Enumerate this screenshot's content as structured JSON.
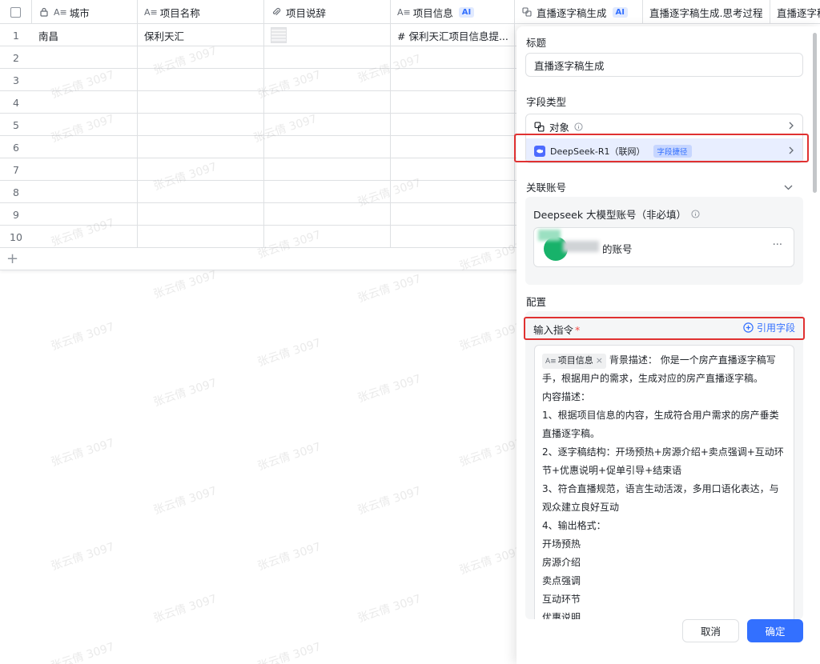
{
  "table": {
    "columns": [
      {
        "name": "城市",
        "icon": "text-field-icon"
      },
      {
        "name": "项目名称",
        "icon": "text-field-icon"
      },
      {
        "name": "项目说辞",
        "icon": "attachment-icon"
      },
      {
        "name": "项目信息",
        "icon": "text-field-icon",
        "tag": "AI"
      },
      {
        "name": "直播逐字稿生成",
        "icon": "object-icon",
        "tag": "AI"
      },
      {
        "name": "直播逐字稿生成.思考过程"
      },
      {
        "name": "直播逐字稿"
      }
    ],
    "rows": [
      {
        "num": "1",
        "city": "南昌",
        "project": "保利天汇",
        "info": "# 保利天汇项目信息提..."
      },
      {
        "num": "2"
      },
      {
        "num": "3"
      },
      {
        "num": "4"
      },
      {
        "num": "5"
      },
      {
        "num": "6"
      },
      {
        "num": "7"
      },
      {
        "num": "8"
      },
      {
        "num": "9"
      },
      {
        "num": "10"
      }
    ],
    "add_row": "+"
  },
  "watermark": "张云倩 3097",
  "panel": {
    "title_label": "标题",
    "title_value": "直播逐字稿生成",
    "type_label": "字段类型",
    "type_value": "对象",
    "model_name": "DeepSeek-R1（联网）",
    "model_tag": "字段捷径",
    "account_label": "关联账号",
    "account_card_title": "Deepseek 大模型账号（非必填）",
    "account_name_suffix": "的账号",
    "more": "···",
    "config_label": "配置",
    "instr_label": "输入指令",
    "required_mark": "*",
    "ref_field": "引用字段",
    "ref_chip": "项目信息",
    "instr_lead": "背景描述： 你是一个房产直播逐字稿写手，根据用户的需求，生成对应的房产直播逐字稿。",
    "instr_lines": [
      "内容描述：",
      "1、根据项目信息的内容，生成符合用户需求的房产垂类直播逐字稿。",
      "2、逐字稿结构：开场预热+房源介绍+卖点强调+互动环节+优惠说明+促单引导+结束语",
      "3、符合直播规范，语言生动活泼，多用口语化表达，与观众建立良好互动",
      "4、输出格式：",
      "开场预热",
      "房源介绍",
      "卖点强调",
      "互动环节",
      "优惠说明"
    ],
    "cancel": "取消",
    "ok": "确定"
  }
}
